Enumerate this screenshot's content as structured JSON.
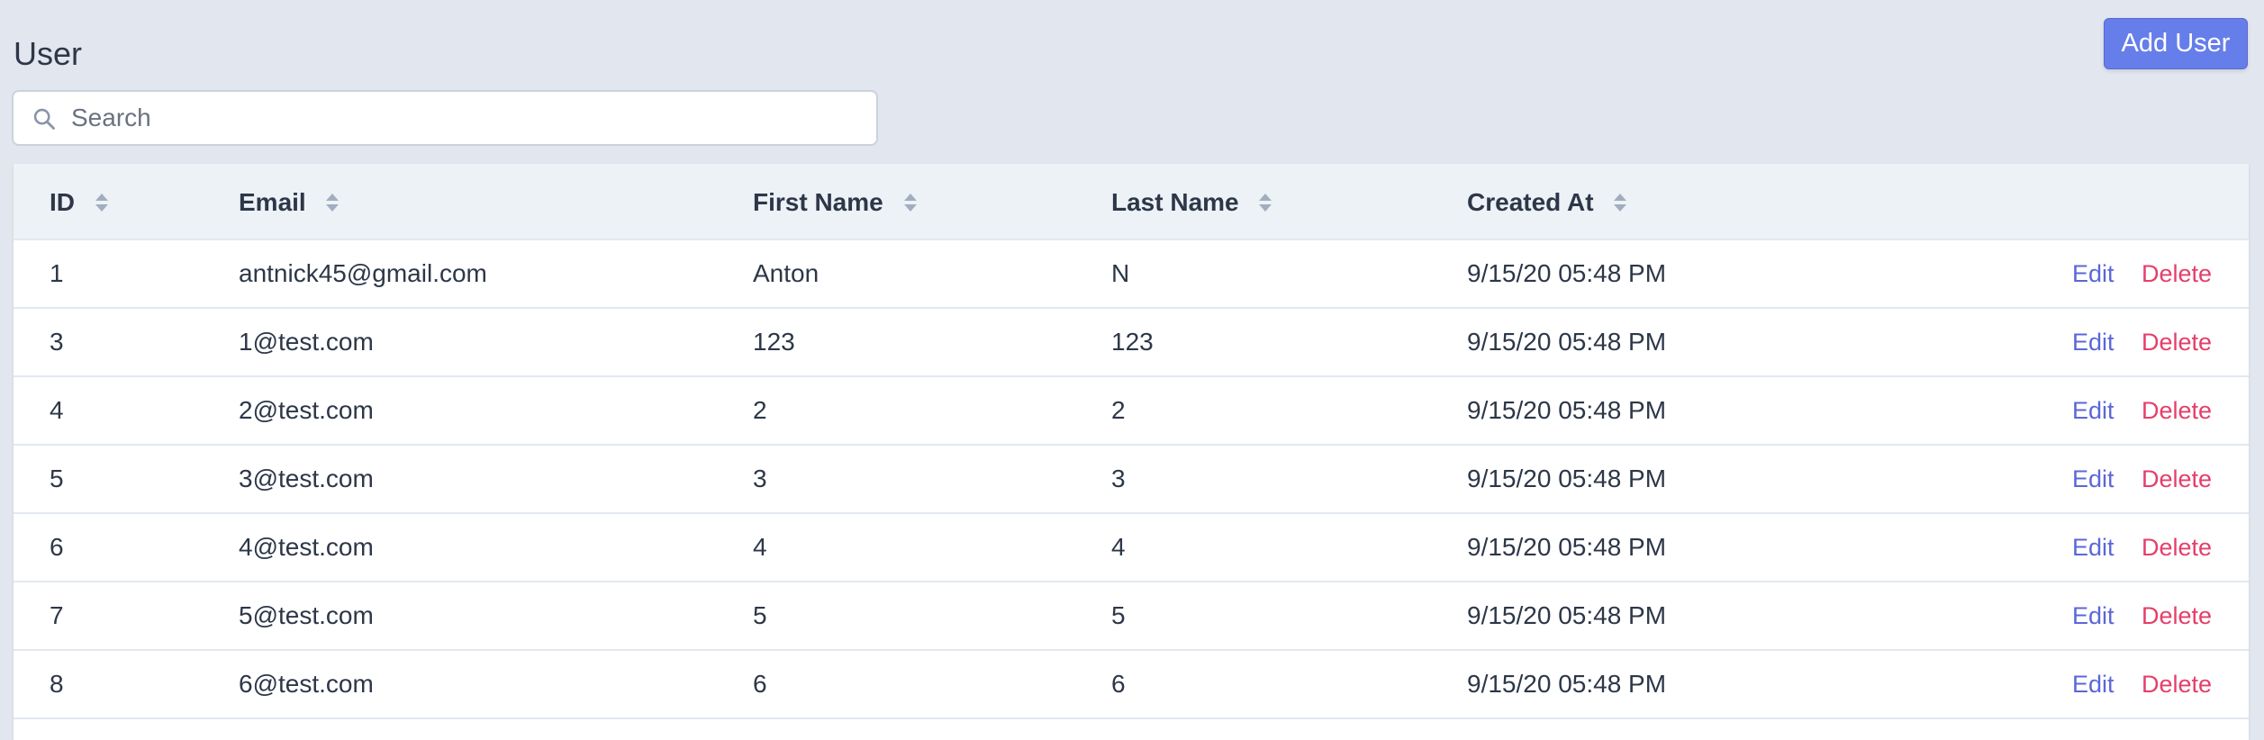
{
  "page": {
    "title": "User",
    "add_button_label": "Add User"
  },
  "search": {
    "placeholder": "Search",
    "value": ""
  },
  "table": {
    "columns": {
      "id": "ID",
      "email": "Email",
      "first_name": "First Name",
      "last_name": "Last Name",
      "created_at": "Created At"
    },
    "action_labels": {
      "edit": "Edit",
      "delete": "Delete"
    },
    "rows": [
      {
        "id": "1",
        "email": "antnick45@gmail.com",
        "first_name": "Anton",
        "last_name": "N",
        "created_at": "9/15/20 05:48 PM"
      },
      {
        "id": "3",
        "email": "1@test.com",
        "first_name": "123",
        "last_name": "123",
        "created_at": "9/15/20 05:48 PM"
      },
      {
        "id": "4",
        "email": "2@test.com",
        "first_name": "2",
        "last_name": "2",
        "created_at": "9/15/20 05:48 PM"
      },
      {
        "id": "5",
        "email": "3@test.com",
        "first_name": "3",
        "last_name": "3",
        "created_at": "9/15/20 05:48 PM"
      },
      {
        "id": "6",
        "email": "4@test.com",
        "first_name": "4",
        "last_name": "4",
        "created_at": "9/15/20 05:48 PM"
      },
      {
        "id": "7",
        "email": "5@test.com",
        "first_name": "5",
        "last_name": "5",
        "created_at": "9/15/20 05:48 PM"
      },
      {
        "id": "8",
        "email": "6@test.com",
        "first_name": "6",
        "last_name": "6",
        "created_at": "9/15/20 05:48 PM"
      }
    ]
  },
  "icons": {
    "search": "search-icon",
    "sort": "sort-icon"
  },
  "colors": {
    "background": "#e2e6ef",
    "primary": "#667eea",
    "edit_link": "#5a67d8",
    "delete_link": "#e53e6a",
    "header_bg": "#edf2f7",
    "text": "#2d3748"
  }
}
